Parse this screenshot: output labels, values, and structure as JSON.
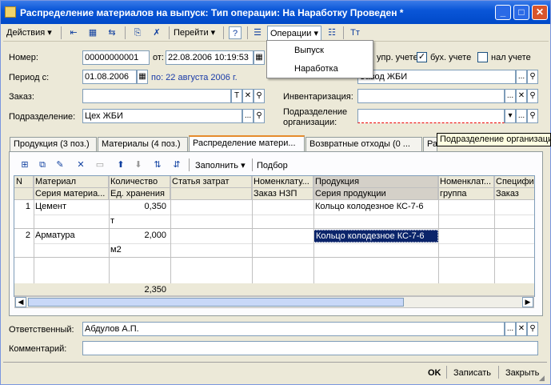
{
  "title": "Распределение материалов на выпуск:  Тип операции: На Наработку Проведен *",
  "toolbar": {
    "actions": "Действия",
    "goto": "Перейти",
    "help": "?",
    "operations": "Операции"
  },
  "operations_menu": [
    "Выпуск",
    "Наработка"
  ],
  "form": {
    "number_label": "Номер:",
    "number_value": "00000000001",
    "date_label": "от:",
    "date_value": "22.08.2006 10:19:53",
    "mgmt_label": "упр. учете",
    "acc_label": "бух. учете",
    "tax_label": "нал учете",
    "period_label": "Период с:",
    "period_value": "01.08.2006",
    "period_to": "по: 22 августа 2006 г.",
    "warehouse_value": "Завод ЖБИ",
    "order_label": "Заказ:",
    "inventory_label": "Инвентаризация:",
    "subdivision_label": "Подразделение:",
    "subdivision_value": "Цех ЖБИ",
    "org_sub_label1": "Подразделение",
    "org_sub_label2": "организации:"
  },
  "tabs": [
    "Продукция (3 поз.)",
    "Материалы (4 поз.)",
    "Распределение матери...",
    "Возвратные отходы (0 ...",
    "Ра"
  ],
  "tooltip": "Подразделение организации",
  "grid_toolbar": {
    "fill": "Заполнить",
    "select": "Подбор"
  },
  "grid": {
    "headers_row1": [
      "N",
      "Материал",
      "Количество",
      "Статья затрат",
      "Номенклату...",
      "Продукция",
      "Номенклат...",
      "Специфи"
    ],
    "headers_row2": [
      "",
      "Серия материа...",
      "Ед. хранения",
      "",
      "Заказ НЗП",
      "Серия продукции",
      "группа",
      "Заказ"
    ],
    "rows": [
      {
        "n": "1",
        "material": "Цемент",
        "qty": "0,350",
        "unit": "т",
        "product": "Кольцо колодезное КС-7-6"
      },
      {
        "n": "2",
        "material": "Арматура",
        "qty": "2,000",
        "unit": "м2",
        "product": "Кольцо колодезное КС-7-6"
      }
    ],
    "total": "2,350"
  },
  "footer": {
    "responsible_label": "Ответственный:",
    "responsible_value": "Абдулов А.П.",
    "comment_label": "Комментарий:",
    "comment_value": ""
  },
  "buttons": {
    "ok": "OK",
    "save": "Записать",
    "close": "Закрыть"
  }
}
